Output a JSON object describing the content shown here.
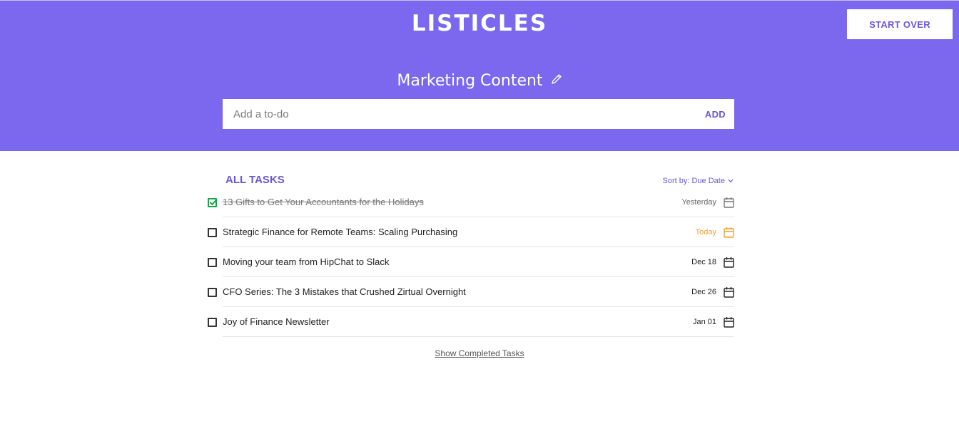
{
  "header": {
    "app_title": "LISTICLES",
    "start_over_label": "START OVER",
    "list_title": "Marketing Content",
    "add_placeholder": "Add a to-do",
    "add_label": "ADD"
  },
  "tasks_section": {
    "title": "ALL TASKS",
    "sort_label": "Sort by: Due Date"
  },
  "tasks": [
    {
      "text": "13 Gifts to Get Your Accountants for the Holidays",
      "due": "Yesterday",
      "completed": true,
      "due_status": "past"
    },
    {
      "text": "Strategic Finance for Remote Teams: Scaling Purchasing",
      "due": "Today",
      "completed": false,
      "due_status": "today"
    },
    {
      "text": "Moving your team from HipChat to Slack",
      "due": "Dec 18",
      "completed": false,
      "due_status": "future"
    },
    {
      "text": "CFO Series: The 3 Mistakes that Crushed Zirtual Overnight",
      "due": "Dec 26",
      "completed": false,
      "due_status": "future"
    },
    {
      "text": "Joy of Finance Newsletter",
      "due": "Jan 01",
      "completed": false,
      "due_status": "future"
    }
  ],
  "footer": {
    "show_completed_label": "Show Completed Tasks"
  },
  "colors": {
    "brand": "#7b68ee",
    "accent_text": "#6a58d8",
    "today": "#f0a030",
    "complete": "#1aa34a"
  },
  "icons": {
    "edit": "pencil-icon",
    "sort": "chevron-down-icon",
    "calendar": "calendar-icon",
    "checkbox": "checkbox-icon"
  }
}
